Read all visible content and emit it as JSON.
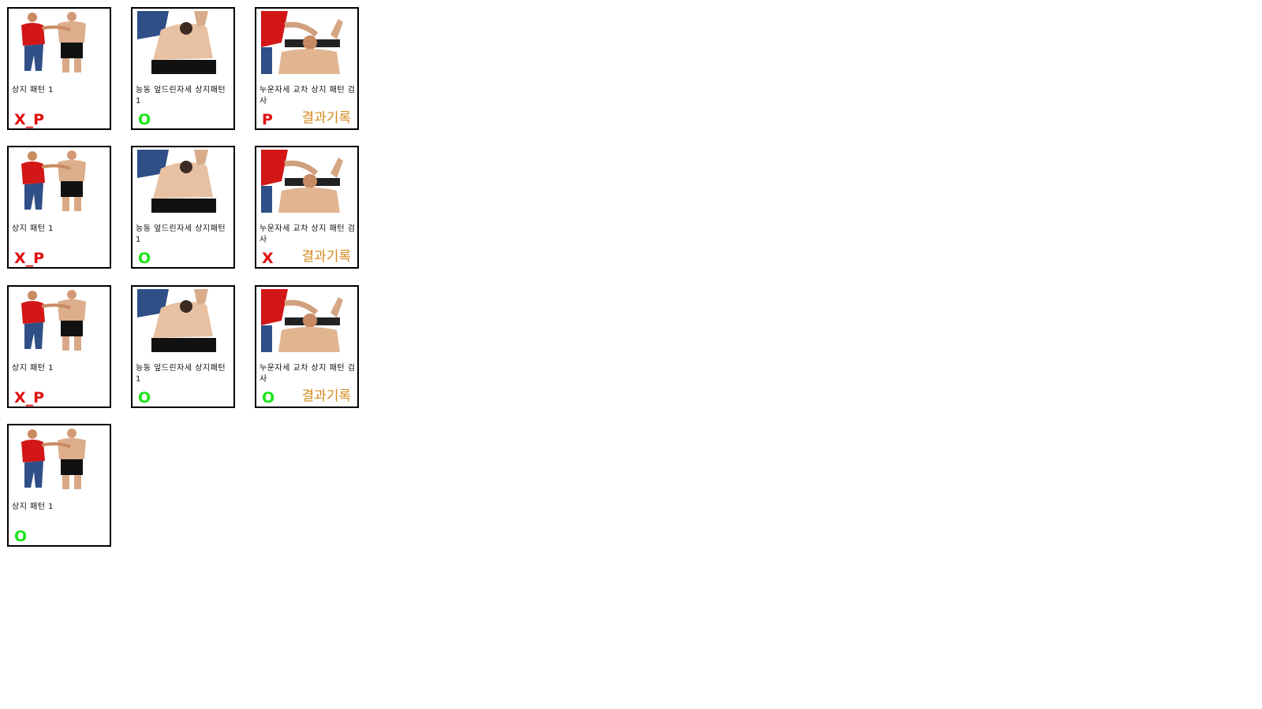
{
  "labels": {
    "pattern1": "상지 패턴 1",
    "active_pattern": "능동 엎드린자세 상지패턴 1",
    "supine_cross": "누운자세 교차 상지 패턴 검사",
    "record": "결과기록"
  },
  "colors": {
    "pass": "#19e619",
    "fail": "#e01010",
    "record": "#d58a1c",
    "border": "#000000"
  },
  "rows": [
    {
      "c1_result": "X_P",
      "c2_result": "O",
      "c3_result": "P"
    },
    {
      "c1_result": "X_P",
      "c2_result": "O",
      "c3_result": "X"
    },
    {
      "c1_result": "X_P",
      "c2_result": "O",
      "c3_result": "O"
    },
    {
      "c1_result": "O"
    }
  ]
}
